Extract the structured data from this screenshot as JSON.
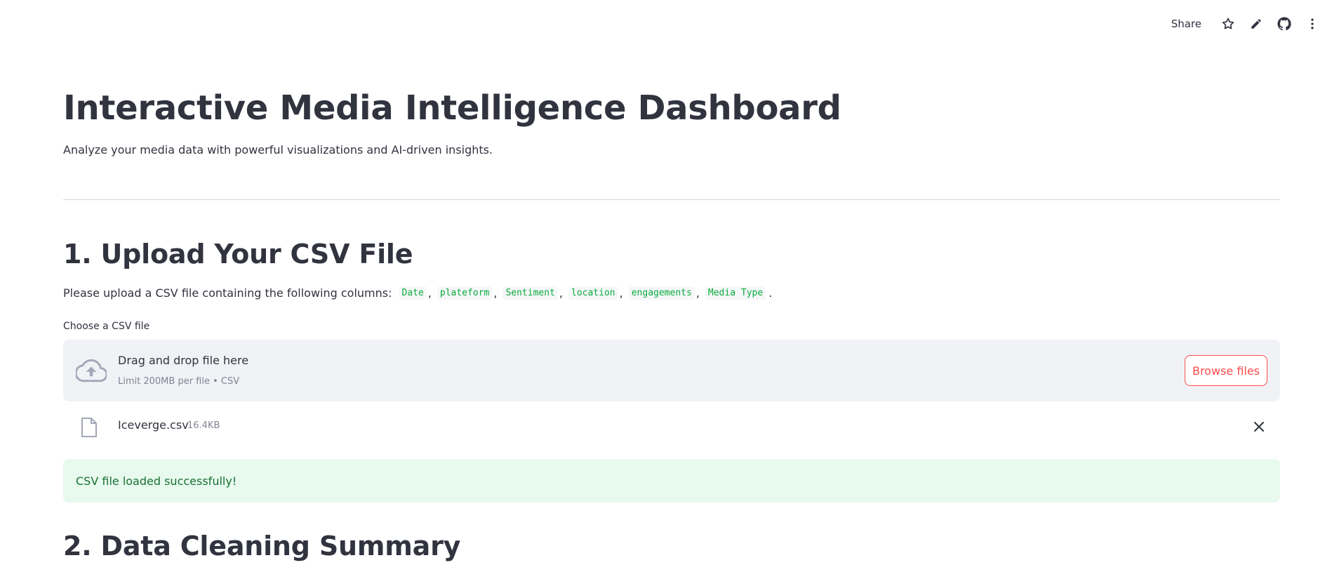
{
  "toolbar": {
    "share_label": "Share",
    "icons": [
      "star-icon",
      "pencil-icon",
      "github-icon",
      "more-vertical-icon"
    ]
  },
  "header": {
    "title": "Interactive Media Intelligence Dashboard",
    "subtitle": "Analyze your media data with powerful visualizations and AI-driven insights."
  },
  "upload_section": {
    "title": "1. Upload Your CSV File",
    "instructions_prefix": "Please upload a CSV file containing the following columns:",
    "columns": [
      "Date",
      "plateform",
      "Sentiment",
      "location",
      "engagements",
      "Media Type"
    ],
    "instructions_suffix": ".",
    "uploader_label": "Choose a CSV file",
    "dropzone": {
      "main_text": "Drag and drop file here",
      "limit_text": "Limit 200MB per file • CSV",
      "browse_label": "Browse files"
    },
    "uploaded_file": {
      "name": "Iceverge.csv",
      "size": "16.4KB"
    },
    "success_message": "CSV file loaded successfully!"
  },
  "cleaning_section": {
    "title": "2. Data Cleaning Summary"
  },
  "colors": {
    "text": "#31333f",
    "accent": "#ff4b4b",
    "code_green": "#09ab3b",
    "success_bg": "#e8f9ee",
    "success_text": "#177233",
    "dropzone_bg": "#f0f2f6"
  }
}
